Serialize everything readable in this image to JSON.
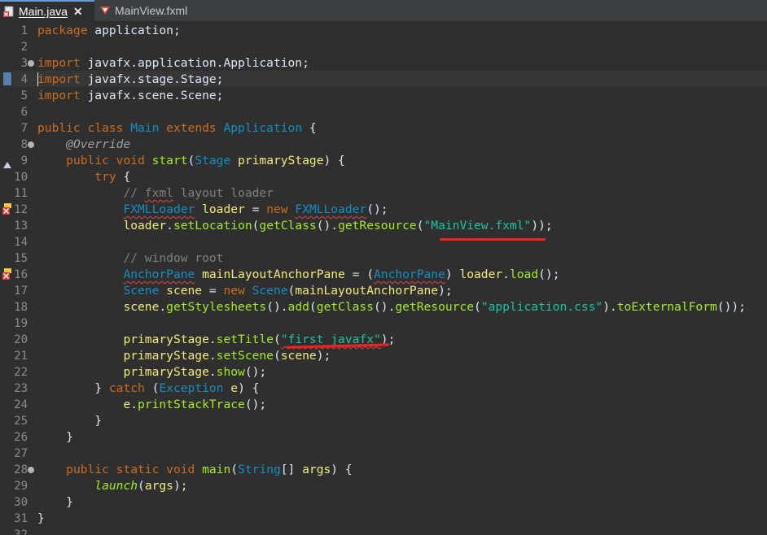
{
  "tabs": [
    {
      "label": "Main.java",
      "close": "✕",
      "active": true
    },
    {
      "label": "MainView.fxml",
      "active": false
    }
  ],
  "colors": {
    "keyword": "#cc6c1d",
    "type": "#1290c3",
    "method": "#a7ec21",
    "variable": "#f3ec79",
    "string": "#17c6a3",
    "comment": "#808080",
    "text": "#d9e8f7",
    "background": "#2f2f2f",
    "highlight": "#ff1e1e"
  },
  "line_numbers": [
    "1",
    "2",
    "3",
    "4",
    "5",
    "6",
    "7",
    "8",
    "9",
    "10",
    "11",
    "12",
    "13",
    "14",
    "15",
    "16",
    "17",
    "18",
    "19",
    "20",
    "21",
    "22",
    "23",
    "24",
    "25",
    "26",
    "27",
    "28",
    "29",
    "30",
    "31",
    "32"
  ],
  "gutter_icons": [
    {
      "line": "9",
      "icon": "override-triangle-icon"
    },
    {
      "line": "12",
      "icon": "warning-error-icon"
    },
    {
      "line": "16",
      "icon": "warning-error-icon"
    }
  ],
  "code": [
    [
      [
        "kw",
        "package"
      ],
      [
        "tx",
        " application;"
      ]
    ],
    [],
    [
      [
        "kw",
        "import"
      ],
      [
        "tx",
        " javafx.application.Application;"
      ]
    ],
    [
      [
        "kw",
        "import"
      ],
      [
        "tx",
        " javafx.stage.Stage;"
      ]
    ],
    [
      [
        "kw",
        "import"
      ],
      [
        "tx",
        " javafx.scene.Scene;"
      ]
    ],
    [],
    [
      [
        "kw",
        "public class "
      ],
      [
        "ty",
        "Main "
      ],
      [
        "kw",
        "extends "
      ],
      [
        "ty",
        "Application"
      ],
      [
        "tx",
        " {"
      ]
    ],
    [
      [
        "tx",
        "    "
      ],
      [
        "an",
        "@Override"
      ]
    ],
    [
      [
        "tx",
        "    "
      ],
      [
        "kw",
        "public void "
      ],
      [
        "fn",
        "start"
      ],
      [
        "tx",
        "("
      ],
      [
        "ty",
        "Stage "
      ],
      [
        "vr",
        "primaryStage"
      ],
      [
        "tx",
        ") {"
      ]
    ],
    [
      [
        "tx",
        "        "
      ],
      [
        "kw",
        "try"
      ],
      [
        "tx",
        " {"
      ]
    ],
    [
      [
        "tx",
        "            "
      ],
      [
        "cm",
        "// "
      ],
      [
        "cm sq",
        "fxml"
      ],
      [
        "cm",
        " layout loader"
      ]
    ],
    [
      [
        "tx",
        "            "
      ],
      [
        "ty sq",
        "FXMLLoader"
      ],
      [
        "tx",
        " "
      ],
      [
        "vr",
        "loader"
      ],
      [
        "tx",
        " = "
      ],
      [
        "kw",
        "new "
      ],
      [
        "ty sq",
        "FXMLLoader"
      ],
      [
        "tx",
        "();"
      ]
    ],
    [
      [
        "tx",
        "            "
      ],
      [
        "vr",
        "loader"
      ],
      [
        "tx",
        "."
      ],
      [
        "fn",
        "setLocation"
      ],
      [
        "tx",
        "("
      ],
      [
        "fn",
        "getClass"
      ],
      [
        "tx",
        "()."
      ],
      [
        "fn",
        "getResource"
      ],
      [
        "tx",
        "("
      ],
      [
        "st",
        "\"MainView.fxml\""
      ],
      [
        "tx",
        "));"
      ]
    ],
    [],
    [
      [
        "tx",
        "            "
      ],
      [
        "cm",
        "// window root"
      ]
    ],
    [
      [
        "tx",
        "            "
      ],
      [
        "ty sq",
        "AnchorPane"
      ],
      [
        "tx",
        " "
      ],
      [
        "vr",
        "mainLayoutAnchorPane"
      ],
      [
        "tx",
        " = ("
      ],
      [
        "ty sq",
        "AnchorPane"
      ],
      [
        "tx",
        ") "
      ],
      [
        "vr",
        "loader"
      ],
      [
        "tx",
        "."
      ],
      [
        "fn",
        "load"
      ],
      [
        "tx",
        "();"
      ]
    ],
    [
      [
        "tx",
        "            "
      ],
      [
        "ty",
        "Scene "
      ],
      [
        "vr",
        "scene"
      ],
      [
        "tx",
        " = "
      ],
      [
        "kw",
        "new "
      ],
      [
        "ty",
        "Scene"
      ],
      [
        "tx",
        "("
      ],
      [
        "vr",
        "mainLayoutAnchorPane"
      ],
      [
        "tx",
        ");"
      ]
    ],
    [
      [
        "tx",
        "            "
      ],
      [
        "vr",
        "scene"
      ],
      [
        "tx",
        "."
      ],
      [
        "fn",
        "getStylesheets"
      ],
      [
        "tx",
        "()."
      ],
      [
        "fn",
        "add"
      ],
      [
        "tx",
        "("
      ],
      [
        "fn",
        "getClass"
      ],
      [
        "tx",
        "()."
      ],
      [
        "fn",
        "getResource"
      ],
      [
        "tx",
        "("
      ],
      [
        "st",
        "\"application.css\""
      ],
      [
        "tx",
        ")."
      ],
      [
        "fn",
        "toExternalForm"
      ],
      [
        "tx",
        "());"
      ]
    ],
    [],
    [
      [
        "tx",
        "            "
      ],
      [
        "vr",
        "primaryStage"
      ],
      [
        "tx",
        "."
      ],
      [
        "fn",
        "setTitle"
      ],
      [
        "tx",
        "("
      ],
      [
        "st sq",
        "\"first javafx\""
      ],
      [
        "tx",
        ");"
      ]
    ],
    [
      [
        "tx",
        "            "
      ],
      [
        "vr",
        "primaryStage"
      ],
      [
        "tx",
        "."
      ],
      [
        "fn",
        "setScene"
      ],
      [
        "tx",
        "("
      ],
      [
        "vr",
        "scene"
      ],
      [
        "tx",
        ");"
      ]
    ],
    [
      [
        "tx",
        "            "
      ],
      [
        "vr",
        "primaryStage"
      ],
      [
        "tx",
        "."
      ],
      [
        "fn",
        "show"
      ],
      [
        "tx",
        "();"
      ]
    ],
    [
      [
        "tx",
        "        } "
      ],
      [
        "kw",
        "catch"
      ],
      [
        "tx",
        " ("
      ],
      [
        "ty",
        "Exception "
      ],
      [
        "vr",
        "e"
      ],
      [
        "tx",
        ") {"
      ]
    ],
    [
      [
        "tx",
        "            "
      ],
      [
        "vr",
        "e"
      ],
      [
        "tx",
        "."
      ],
      [
        "fn",
        "printStackTrace"
      ],
      [
        "tx",
        "();"
      ]
    ],
    [
      [
        "tx",
        "        }"
      ]
    ],
    [
      [
        "tx",
        "    }"
      ]
    ],
    [],
    [
      [
        "tx",
        "    "
      ],
      [
        "kw",
        "public static void "
      ],
      [
        "fn",
        "main"
      ],
      [
        "tx",
        "("
      ],
      [
        "ty",
        "String"
      ],
      [
        "tx",
        "[] "
      ],
      [
        "vr",
        "args"
      ],
      [
        "tx",
        ") {"
      ]
    ],
    [
      [
        "tx",
        "        "
      ],
      [
        "it",
        "launch"
      ],
      [
        "tx",
        "("
      ],
      [
        "vr",
        "args"
      ],
      [
        "tx",
        ");"
      ]
    ],
    [
      [
        "tx",
        "    }"
      ]
    ],
    [
      [
        "tx",
        "}"
      ]
    ]
  ]
}
